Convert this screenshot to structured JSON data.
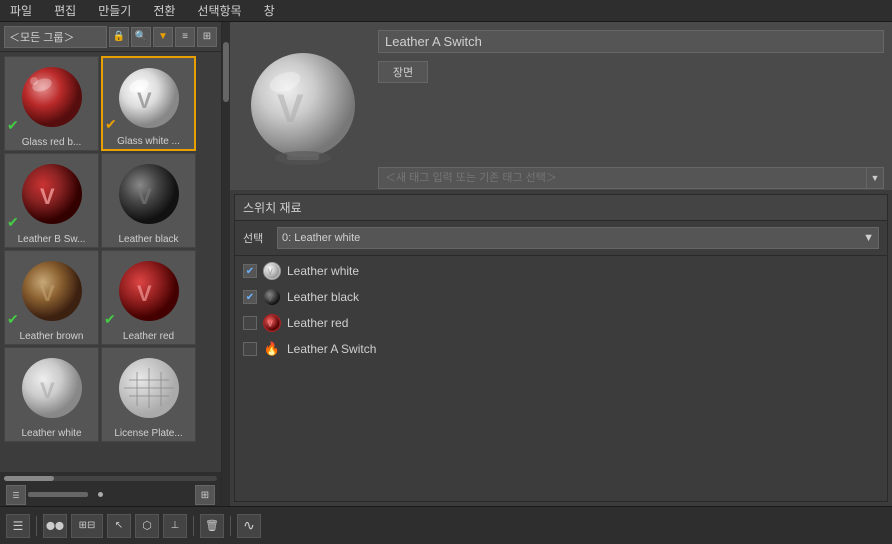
{
  "menubar": {
    "items": [
      "파일",
      "편집",
      "만들기",
      "전환",
      "선택항목",
      "창"
    ]
  },
  "left_panel": {
    "group_dropdown": "＜모든 그룹＞",
    "materials": [
      {
        "id": "glass-red",
        "label": "Glass red b...",
        "badge": "✔",
        "badge_color": "green",
        "sphere_type": "glass_red"
      },
      {
        "id": "glass-white",
        "label": "Glass white ...",
        "badge": "✔",
        "badge_color": "orange",
        "sphere_type": "glass_white",
        "selected": true
      },
      {
        "id": "leather-b-sw",
        "label": "Leather B Sw...",
        "badge": "✔",
        "badge_color": "green",
        "sphere_type": "leather_brown_sw"
      },
      {
        "id": "leather-black",
        "label": "Leather black",
        "badge": "",
        "sphere_type": "leather_black"
      },
      {
        "id": "leather-brown",
        "label": "Leather brown",
        "badge": "✔",
        "badge_color": "green",
        "sphere_type": "leather_brown"
      },
      {
        "id": "leather-red",
        "label": "Leather red",
        "badge": "✔",
        "badge_color": "green",
        "sphere_type": "leather_red"
      },
      {
        "id": "leather-white",
        "label": "Leather white",
        "badge": "",
        "sphere_type": "leather_white"
      },
      {
        "id": "license-plate",
        "label": "License Plate...",
        "badge": "",
        "sphere_type": "license_plate"
      }
    ]
  },
  "right_panel": {
    "mat_name": "Leather A Switch",
    "scene_label": "장면",
    "tag_placeholder": "＜새 태그 입력 또는 기존 태그 선택＞",
    "switch_panel": {
      "header": "스위치 재료",
      "select_label": "선택",
      "selected_option": "0: Leather white",
      "materials": [
        {
          "id": "lw",
          "label": "Leather white",
          "checked": true,
          "icon_type": "white"
        },
        {
          "id": "lb",
          "label": "Leather black",
          "checked": true,
          "icon_type": "black"
        },
        {
          "id": "lr",
          "label": "Leather red",
          "checked": false,
          "icon_type": "red"
        },
        {
          "id": "la-sw",
          "label": "Leather A Switch",
          "checked": false,
          "icon_type": "orange"
        }
      ]
    }
  },
  "bottom_toolbar": {
    "buttons": [
      "≡",
      "⬤⬤",
      "▦",
      "↖",
      "◈",
      "⊥",
      "🗑",
      "∿"
    ]
  }
}
